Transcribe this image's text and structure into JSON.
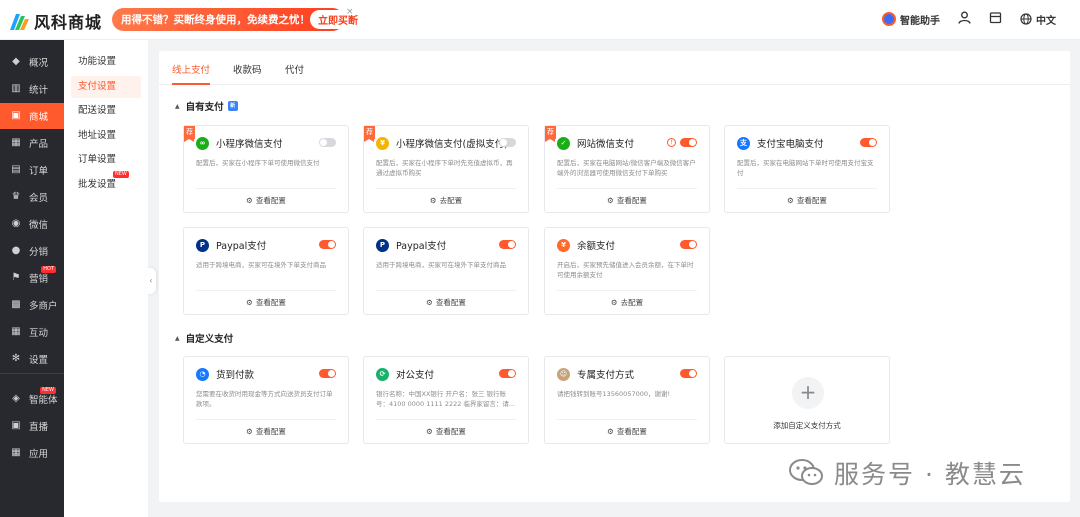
{
  "header": {
    "logo_text": "风科商城",
    "promo_text": "用得不错？买断终身使用，免续费之忧！",
    "promo_button": "立即买断",
    "promo_close": "×",
    "assistant_label": "智能助手",
    "language_label": "中文"
  },
  "sidebar": {
    "items": [
      {
        "label": "概况",
        "icon": "layers-icon",
        "glyph": "◆"
      },
      {
        "label": "统计",
        "icon": "chart-icon",
        "glyph": "▥"
      },
      {
        "label": "商城",
        "icon": "shop-icon",
        "glyph": "▣"
      },
      {
        "label": "产品",
        "icon": "grid-icon",
        "glyph": "▦"
      },
      {
        "label": "订单",
        "icon": "order-icon",
        "glyph": "▤"
      },
      {
        "label": "会员",
        "icon": "crown-icon",
        "glyph": "♛"
      },
      {
        "label": "微信",
        "icon": "wechat-icon",
        "glyph": "◉"
      },
      {
        "label": "分销",
        "icon": "users-icon",
        "glyph": "●"
      },
      {
        "label": "营销",
        "icon": "flag-icon",
        "glyph": "⚑",
        "badge": "HOT"
      },
      {
        "label": "多商户",
        "icon": "store-icon",
        "glyph": "▩"
      },
      {
        "label": "互动",
        "icon": "apps-icon",
        "glyph": "▦"
      },
      {
        "label": "设置",
        "icon": "gear-icon",
        "glyph": "✻"
      },
      {
        "label": "智能体",
        "icon": "cube-icon",
        "glyph": "◈",
        "badge": "NEW"
      },
      {
        "label": "直播",
        "icon": "tv-icon",
        "glyph": "▣"
      },
      {
        "label": "应用",
        "icon": "app-grid-icon",
        "glyph": "▦"
      }
    ]
  },
  "submenu": {
    "items": [
      {
        "label": "功能设置"
      },
      {
        "label": "支付设置"
      },
      {
        "label": "配送设置"
      },
      {
        "label": "地址设置"
      },
      {
        "label": "订单设置"
      },
      {
        "label": "批发设置",
        "badge": "NEW"
      }
    ],
    "collapse_glyph": "‹"
  },
  "tabs": [
    {
      "label": "线上支付"
    },
    {
      "label": "收款码"
    },
    {
      "label": "代付"
    }
  ],
  "sections": {
    "own": {
      "title": "自有支付",
      "badge": "新"
    },
    "custom": {
      "title": "自定义支付"
    }
  },
  "cards": [
    {
      "title": "小程序微信支付",
      "desc": "配置后，买家在小程序下单可使用微信支付",
      "action": "查看配置",
      "enabled": false,
      "recommended": true,
      "icon_color": "#1aad19",
      "glyph": "∞"
    },
    {
      "title": "小程序微信支付(虚拟支付)",
      "desc": "配置后，买家在小程序下单时先充值虚拟币，再通过虚拟币购买",
      "action": "去配置",
      "enabled": false,
      "recommended": true,
      "icon_color": "#f5b400",
      "glyph": "¥"
    },
    {
      "title": "网站微信支付",
      "desc": "配置后，买家在电脑网站/微信客户端及微信客户端外的浏览器可使用微信支付下单购买",
      "action": "查看配置",
      "enabled": true,
      "recommended": true,
      "warning": true,
      "icon_color": "#1aad19",
      "glyph": "✓"
    },
    {
      "title": "支付宝电脑支付",
      "desc": "配置后，买家在电脑网站下单时可使用支付宝支付",
      "action": "查看配置",
      "enabled": true,
      "icon_color": "#1677ff",
      "glyph": "支"
    },
    {
      "title": "Paypal支付",
      "desc": "适用于跨境电商，买家可在境外下单支付商品",
      "action": "查看配置",
      "enabled": true,
      "icon_color": "#003087",
      "glyph": "P"
    },
    {
      "title": "Paypal支付",
      "desc": "适用于跨境电商，买家可在境外下单支付商品",
      "action": "查看配置",
      "enabled": true,
      "icon_color": "#003087",
      "glyph": "P"
    },
    {
      "title": "余额支付",
      "desc": "开启后，买家预先储值进入会员余额，在下单时可使用余额支付",
      "action": "去配置",
      "enabled": true,
      "icon_color": "#ff6a2b",
      "glyph": "¥"
    },
    {
      "title": "货到付款",
      "desc": "您需要在收货时用现金等方式向送货员支付订单款项。",
      "action": "查看配置",
      "enabled": true,
      "icon_color": "#1677ff",
      "glyph": "◔"
    },
    {
      "title": "对公支付",
      "desc": "银行名称：中国XX银行 开户名：张三 银行账号：4100 0000 1111 2222 临界家留言：请...",
      "action": "查看配置",
      "enabled": true,
      "icon_color": "#19b26b",
      "glyph": "⟳"
    },
    {
      "title": "专属支付方式",
      "desc": "请把钱转到账号13560057000，谢谢!",
      "action": "查看配置",
      "enabled": true,
      "icon_color": "#c9a27a",
      "glyph": "☺"
    }
  ],
  "add_card": {
    "plus": "+",
    "label": "添加自定义支付方式"
  },
  "watermark": {
    "text": "服务号 · 教慧云"
  },
  "colors": {
    "accent": "#ff5a2e",
    "sidebar_bg": "#27292f",
    "toggle_off": "#d6d8dc"
  }
}
